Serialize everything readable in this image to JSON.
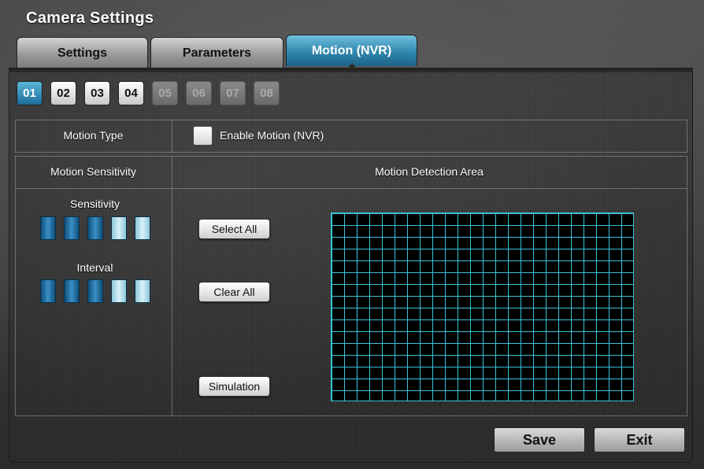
{
  "window": {
    "title": "Camera Settings"
  },
  "tabs": [
    {
      "label": "Settings",
      "active": false
    },
    {
      "label": "Parameters",
      "active": false
    },
    {
      "label": "Motion (NVR)",
      "active": true
    }
  ],
  "channels": [
    {
      "label": "01",
      "state": "active"
    },
    {
      "label": "02",
      "state": "normal"
    },
    {
      "label": "03",
      "state": "normal"
    },
    {
      "label": "04",
      "state": "normal"
    },
    {
      "label": "05",
      "state": "disabled"
    },
    {
      "label": "06",
      "state": "disabled"
    },
    {
      "label": "07",
      "state": "disabled"
    },
    {
      "label": "08",
      "state": "disabled"
    }
  ],
  "motion_type": {
    "label": "Motion Type",
    "enable_label": "Enable Motion (NVR)",
    "enabled": false
  },
  "sensitivity_section": {
    "header": "Motion Sensitivity",
    "sensitivity_label": "Sensitivity",
    "sensitivity_level": 3,
    "sensitivity_max": 5,
    "interval_label": "Interval",
    "interval_level": 3,
    "interval_max": 5
  },
  "detection_area": {
    "header": "Motion Detection Area",
    "select_all": "Select All",
    "clear_all": "Clear All",
    "simulation": "Simulation",
    "grid_color": "#39c4d6"
  },
  "footer": {
    "save": "Save",
    "exit": "Exit"
  },
  "colors": {
    "accent": "#2f86ad",
    "level_on": "#1b6d99",
    "level_off": "#bfe6f1"
  }
}
